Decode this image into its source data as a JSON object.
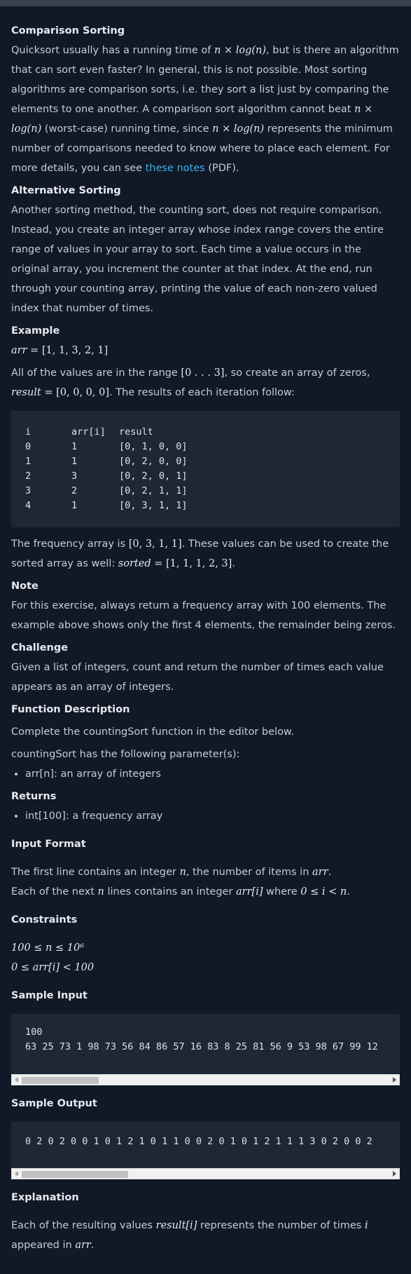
{
  "sections": {
    "comparison": {
      "title": "Comparison Sorting",
      "p1a": "Quicksort usually has a running time of ",
      "p1m": "n × log(n)",
      "p1b": ", but is there an algorithm that can sort even faster? In general, this is not possible. Most sorting algorithms are comparison sorts, i.e. they sort a list just by comparing the elements to one another. A comparison sort algorithm cannot beat ",
      "p1m2": "n × log(n)",
      "p1c": " (worst-case) running time, since ",
      "p1m3": "n × log(n)",
      "p1d": " represents the minimum number of comparisons needed to know where to place each element. For more details, you can see ",
      "link": "these notes",
      "p1e": " (PDF)."
    },
    "alternative": {
      "title": "Alternative Sorting",
      "p": "Another sorting method, the counting sort, does not require comparison. Instead, you create an integer array whose index range covers the entire range of values in your array to sort. Each time a value occurs in the original array, you increment the counter at that index. At the end, run through your counting array, printing the value of each non-zero valued index that number of times."
    },
    "example": {
      "title": "Example",
      "arr_var": "arr",
      "arr_val": " = [1, 1, 3, 2, 1]",
      "p1a": "All of the values are in the range ",
      "range": "[0 . . . 3]",
      "p1b": ", so create an array of zeros,",
      "result_var": "result",
      "result_val": " = [0, 0, 0, 0]",
      "p1c": ". The results of each iteration follow:",
      "table": {
        "headers": [
          "i",
          "arr[i]",
          "result"
        ],
        "rows": [
          [
            "0",
            "1",
            "[0, 1, 0, 0]"
          ],
          [
            "1",
            "1",
            "[0, 2, 0, 0]"
          ],
          [
            "2",
            "3",
            "[0, 2, 0, 1]"
          ],
          [
            "3",
            "2",
            "[0, 2, 1, 1]"
          ],
          [
            "4",
            "1",
            "[0, 3, 1, 1]"
          ]
        ]
      },
      "p2a": "The frequency array is ",
      "freq": "[0, 3, 1, 1]",
      "p2b": ". These values can be used to create the sorted array as well: ",
      "sorted_var": "sorted",
      "sorted_val": " = [1, 1, 1, 2, 3]",
      "p2c": "."
    },
    "note": {
      "title": "Note",
      "p": "For this exercise, always return a frequency array with 100 elements. The example above shows only the first 4 elements, the remainder being zeros."
    },
    "challenge": {
      "title": "Challenge",
      "p": "Given a list of integers, count and return the number of times each value appears as an array of integers."
    },
    "function": {
      "title": "Function Description",
      "p1": "Complete the countingSort function in the editor below.",
      "p2": "countingSort has the following parameter(s):",
      "item": "arr[n]: an array of integers"
    },
    "returns": {
      "title": "Returns",
      "item": "int[100]: a frequency array"
    },
    "input": {
      "title": "Input Format",
      "l1a": "The first line contains an integer ",
      "l1m": "n",
      "l1b": ", the number of items in ",
      "l1m2": "arr",
      "l1c": ".",
      "l2a": "Each of the next ",
      "l2m": "n",
      "l2b": " lines contains an integer ",
      "l2m2": "arr[i]",
      "l2c": " where ",
      "l2m3": "0 ≤ i < n",
      "l2d": "."
    },
    "constraints": {
      "title": "Constraints",
      "c1": "100 ≤ n ≤ 10⁶",
      "c2": "0 ≤ arr[i] < 100"
    },
    "sample_input": {
      "title": "Sample Input",
      "line1": "100",
      "line2": "63 25 73 1 98 73 56 84 86 57 16 83 8 25 81 56 9 53 98 67 99 12"
    },
    "sample_output": {
      "title": "Sample Output",
      "line1": "0 2 0 2 0 0 1 0 1 2 1 0 1 1 0 0 2 0 1 0 1 2 1 1 1 3 0 2 0 0 2"
    },
    "explanation": {
      "title": "Explanation",
      "pa": "Each of the resulting values ",
      "pm": "result[i]",
      "pb": " represents the number of times ",
      "pm2": "i",
      "pc": " appeared in ",
      "pm3": "arr",
      "pd": "."
    }
  },
  "scroll": {
    "input_thumb_fraction": 0.21,
    "output_thumb_fraction": 0.29
  }
}
